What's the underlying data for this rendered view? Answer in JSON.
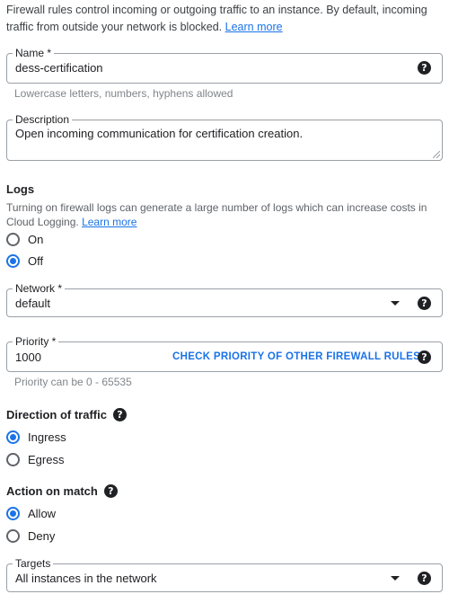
{
  "intro": {
    "text": "Firewall rules control incoming or outgoing traffic to an instance. By default, incoming traffic from outside your network is blocked.",
    "link": "Learn more"
  },
  "name": {
    "label": "Name *",
    "value": "dess-certification",
    "hint": "Lowercase letters, numbers, hyphens allowed",
    "help_icon": "help-icon"
  },
  "description": {
    "label": "Description",
    "value": "Open incoming communication for certification creation."
  },
  "logs": {
    "title": "Logs",
    "text": "Turning on firewall logs can generate a large number of logs which can increase costs in Cloud Logging.",
    "link": "Learn more",
    "options": [
      {
        "label": "On",
        "checked": false
      },
      {
        "label": "Off",
        "checked": true
      }
    ]
  },
  "network": {
    "label": "Network *",
    "value": "default"
  },
  "priority": {
    "label": "Priority *",
    "value": "1000",
    "action": "CHECK PRIORITY OF OTHER FIREWALL RULES",
    "hint": "Priority can be 0 - 65535"
  },
  "direction": {
    "title": "Direction of traffic",
    "options": [
      {
        "label": "Ingress",
        "checked": true
      },
      {
        "label": "Egress",
        "checked": false
      }
    ]
  },
  "action_on_match": {
    "title": "Action on match",
    "options": [
      {
        "label": "Allow",
        "checked": true
      },
      {
        "label": "Deny",
        "checked": false
      }
    ]
  },
  "targets": {
    "label": "Targets",
    "value": "All instances in the network"
  },
  "colors": {
    "accent": "#1a73e8",
    "border": "#9aa0a6",
    "text": "#202124",
    "hint": "#80868b"
  }
}
